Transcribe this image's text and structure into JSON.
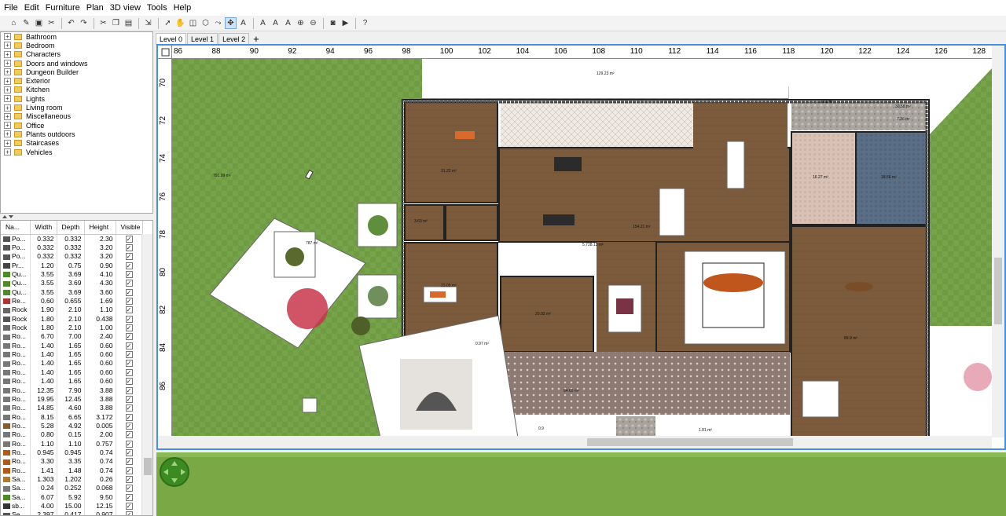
{
  "menu": [
    "File",
    "Edit",
    "Furniture",
    "Plan",
    "3D view",
    "Tools",
    "Help"
  ],
  "toolbar": {
    "icons": [
      "new-home-icon",
      "open-icon",
      "save-icon",
      "cut-icon",
      "undo-icon",
      "redo-icon",
      "cut-icon",
      "copy-icon",
      "paste-icon",
      "paste-style-icon",
      "add-furniture-icon",
      "select-icon",
      "pan-icon",
      "create-walls-icon",
      "create-rooms-icon",
      "create-polylines-icon",
      "create-dimensions-icon",
      "create-labels-icon",
      "text-style-icon",
      "text-increase-icon",
      "text-decrease-icon",
      "zoom-in-icon",
      "zoom-out-icon",
      "create-photo-icon",
      "create-video-icon",
      "help-icon"
    ]
  },
  "catalog": {
    "categories": [
      "Bathroom",
      "Bedroom",
      "Characters",
      "Doors and windows",
      "Dungeon Builder",
      "Exterior",
      "Kitchen",
      "Lights",
      "Living room",
      "Miscellaneous",
      "Office",
      "Plants outdoors",
      "Staircases",
      "Vehicles"
    ]
  },
  "furniture_table": {
    "headers": [
      "Na...",
      "Width",
      "Depth",
      "Height",
      "Visible"
    ],
    "rows": [
      [
        "Po...",
        "0.332",
        "0.332",
        "2.30"
      ],
      [
        "Po...",
        "0.332",
        "0.332",
        "3.20"
      ],
      [
        "Po...",
        "0.332",
        "0.332",
        "3.20"
      ],
      [
        "Pr...",
        "1.20",
        "0.75",
        "0.90"
      ],
      [
        "Qu...",
        "3.55",
        "3.69",
        "4.10"
      ],
      [
        "Qu...",
        "3.55",
        "3.69",
        "4.30"
      ],
      [
        "Qu...",
        "3.55",
        "3.69",
        "3.60"
      ],
      [
        "Re...",
        "0.60",
        "0.655",
        "1.69"
      ],
      [
        "Rock",
        "1.90",
        "2.10",
        "1.10"
      ],
      [
        "Rock",
        "1.80",
        "2.10",
        "0.438"
      ],
      [
        "Rock",
        "1.80",
        "2.10",
        "1.00"
      ],
      [
        "Ro...",
        "6.70",
        "7.00",
        "2.40"
      ],
      [
        "Ro...",
        "1.40",
        "1.65",
        "0.60"
      ],
      [
        "Ro...",
        "1.40",
        "1.65",
        "0.60"
      ],
      [
        "Ro...",
        "1.40",
        "1.65",
        "0.60"
      ],
      [
        "Ro...",
        "1.40",
        "1.65",
        "0.60"
      ],
      [
        "Ro...",
        "1.40",
        "1.65",
        "0.60"
      ],
      [
        "Ro...",
        "12.35",
        "7.90",
        "3.88"
      ],
      [
        "Ro...",
        "19.95",
        "12.45",
        "3.88"
      ],
      [
        "Ro...",
        "14.85",
        "4.60",
        "3.88"
      ],
      [
        "Ro...",
        "8.15",
        "6.65",
        "3.172"
      ],
      [
        "Ro...",
        "5.28",
        "4.92",
        "0.005"
      ],
      [
        "Ro...",
        "0.80",
        "0.15",
        "2.00"
      ],
      [
        "Ro...",
        "1.10",
        "1.10",
        "0.757"
      ],
      [
        "Ro...",
        "0.945",
        "0.945",
        "0.74"
      ],
      [
        "Ro...",
        "3.30",
        "3.35",
        "0.74"
      ],
      [
        "Ro...",
        "1.41",
        "1.48",
        "0.74"
      ],
      [
        "Sa...",
        "1.303",
        "1.202",
        "0.26"
      ],
      [
        "Sa...",
        "0.24",
        "0.252",
        "0.068"
      ],
      [
        "Sa...",
        "6.07",
        "5.92",
        "9.50"
      ],
      [
        "sb...",
        "4.00",
        "15.00",
        "12.15"
      ],
      [
        "Se...",
        "2.397",
        "0.417",
        "0.907"
      ]
    ],
    "row_icons": [
      "#555",
      "#555",
      "#555",
      "#444",
      "#4e8a2a",
      "#4e8a2a",
      "#4e8a2a",
      "#a33",
      "#666",
      "#555",
      "#666",
      "#777",
      "#777",
      "#777",
      "#777",
      "#777",
      "#777",
      "#777",
      "#777",
      "#777",
      "#777",
      "#8a5a2a",
      "#777",
      "#777",
      "#b05a1a",
      "#b05a1a",
      "#b05a1a",
      "#b07a2a",
      "#777",
      "#4e8a2a",
      "#333",
      "#555"
    ]
  },
  "levels": [
    "Level 0",
    "Level 1",
    "Level 2"
  ],
  "add_level_label": "+",
  "plan": {
    "ruler_x": [
      "86",
      "88",
      "90",
      "92",
      "94",
      "96",
      "98",
      "100",
      "102",
      "104",
      "106",
      "108",
      "110",
      "112",
      "114",
      "116",
      "118",
      "120",
      "122",
      "124",
      "126",
      "128"
    ],
    "ruler_y": [
      "70",
      "72",
      "74",
      "76",
      "78",
      "80",
      "82",
      "84",
      "86"
    ],
    "areas": [
      "791.99 m²",
      "787 m²",
      "129.23 m²",
      "31.22 m²",
      "3.63 m²",
      "154.21 m²",
      "5,728.13 m²",
      "23.05 m²",
      "20.02 m²",
      "0.97 m²",
      "2.81 m²",
      "30.58 m²",
      "7.36 m²",
      "16.27 m²",
      "18.56 m²",
      "89.9 m²",
      "84.65 m²",
      "0.9",
      "1.81 m²"
    ]
  }
}
